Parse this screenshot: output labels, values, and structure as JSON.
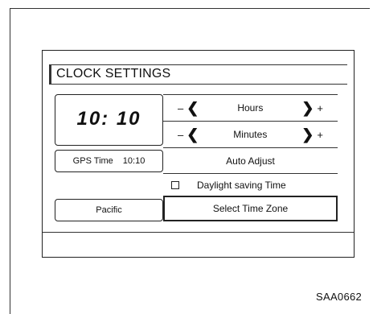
{
  "screen": {
    "title": "CLOCK SETTINGS",
    "clock_display": "10: 10",
    "gps_label": "GPS Time",
    "gps_value": "10:10",
    "timezone_value": "Pacific"
  },
  "controls": {
    "minus": "–",
    "plus": "+",
    "chevron_left": "❮",
    "chevron_right": "❯",
    "hours_label": "Hours",
    "minutes_label": "Minutes",
    "auto_adjust_label": "Auto Adjust",
    "daylight_saving_label": "Daylight saving Time",
    "daylight_saving_checked": false,
    "select_time_zone_label": "Select Time Zone"
  },
  "figure": {
    "reference_code": "SAA0662"
  }
}
